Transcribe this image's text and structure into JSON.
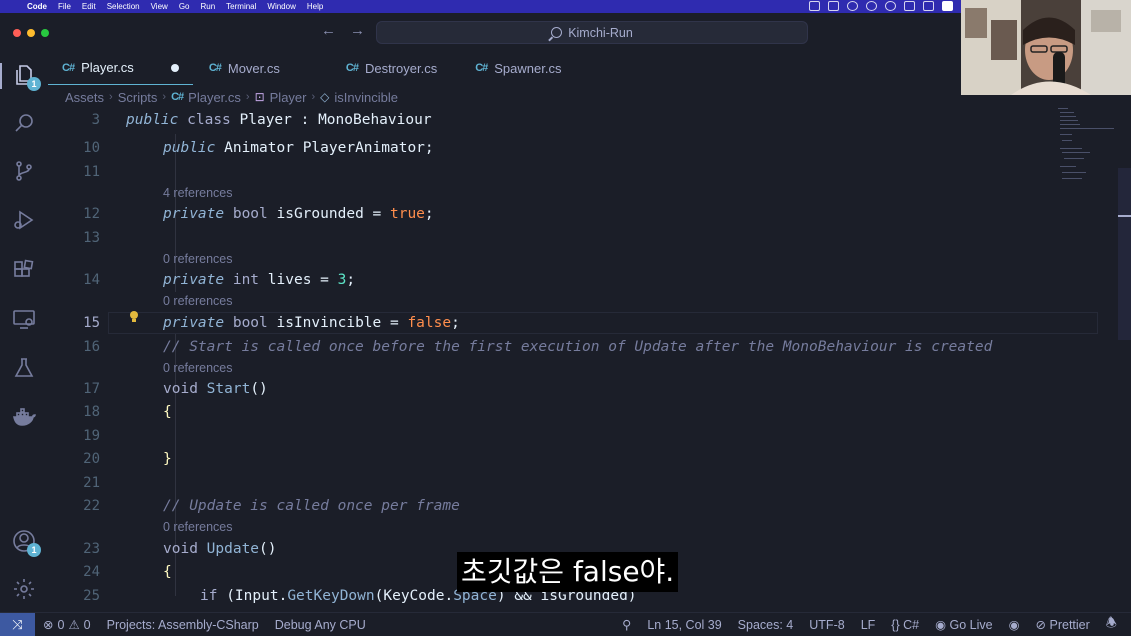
{
  "menubar": {
    "app": "Code",
    "items": [
      "File",
      "Edit",
      "Selection",
      "View",
      "Go",
      "Run",
      "Terminal",
      "Window",
      "Help"
    ]
  },
  "titlebar": {
    "search_text": "Kimchi-Run"
  },
  "activity": {
    "explorer_badge": "1",
    "accounts_badge": "1"
  },
  "tabs": [
    {
      "label": "Player.cs",
      "active": true,
      "dirty": true
    },
    {
      "label": "Mover.cs"
    },
    {
      "label": "Destroyer.cs"
    },
    {
      "label": "Spawner.cs"
    }
  ],
  "breadcrumb": [
    "Assets",
    "Scripts",
    "Player.cs",
    "Player",
    "isInvincible"
  ],
  "editor": {
    "current_line": "15",
    "lines": [
      {
        "num": "3",
        "text": "public class Player : MonoBehaviour"
      },
      {
        "num": "10",
        "text": "public Animator PlayerAnimator;"
      },
      {
        "num": "11",
        "text": ""
      },
      {
        "lens": "4 references"
      },
      {
        "num": "12",
        "text": "private bool isGrounded = true;"
      },
      {
        "num": "13",
        "text": ""
      },
      {
        "lens": "0 references"
      },
      {
        "num": "14",
        "text": "private int lives = 3;"
      },
      {
        "lens": "0 references"
      },
      {
        "num": "15",
        "text": "private bool isInvincible = false;"
      },
      {
        "num": "16",
        "text": "// Start is called once before the first execution of Update after the MonoBehaviour is created"
      },
      {
        "lens": "0 references"
      },
      {
        "num": "17",
        "text": "void Start()"
      },
      {
        "num": "18",
        "text": "{"
      },
      {
        "num": "19",
        "text": ""
      },
      {
        "num": "20",
        "text": "}"
      },
      {
        "num": "21",
        "text": ""
      },
      {
        "num": "22",
        "text": "// Update is called once per frame"
      },
      {
        "lens": "0 references"
      },
      {
        "num": "23",
        "text": "void Update()"
      },
      {
        "num": "24",
        "text": "{"
      },
      {
        "num": "25",
        "text": "if (Input.GetKeyDown(KeyCode.Space) && isGrounded)"
      }
    ]
  },
  "subtitle": "초깃값은 false야.",
  "statusbar": {
    "errors": "0",
    "warnings": "0",
    "project": "Projects: Assembly-CSharp",
    "config": "Debug Any CPU",
    "position": "Ln 15, Col 39",
    "spaces": "Spaces: 4",
    "encoding": "UTF-8",
    "eol": "LF",
    "language": "C#",
    "golive": "Go Live",
    "prettier": "Prettier"
  },
  "colors": {
    "background": "#1b1e28",
    "menubar": "#2f2bb0",
    "accent": "#5fb3d3",
    "remote": "#3d59a1"
  }
}
